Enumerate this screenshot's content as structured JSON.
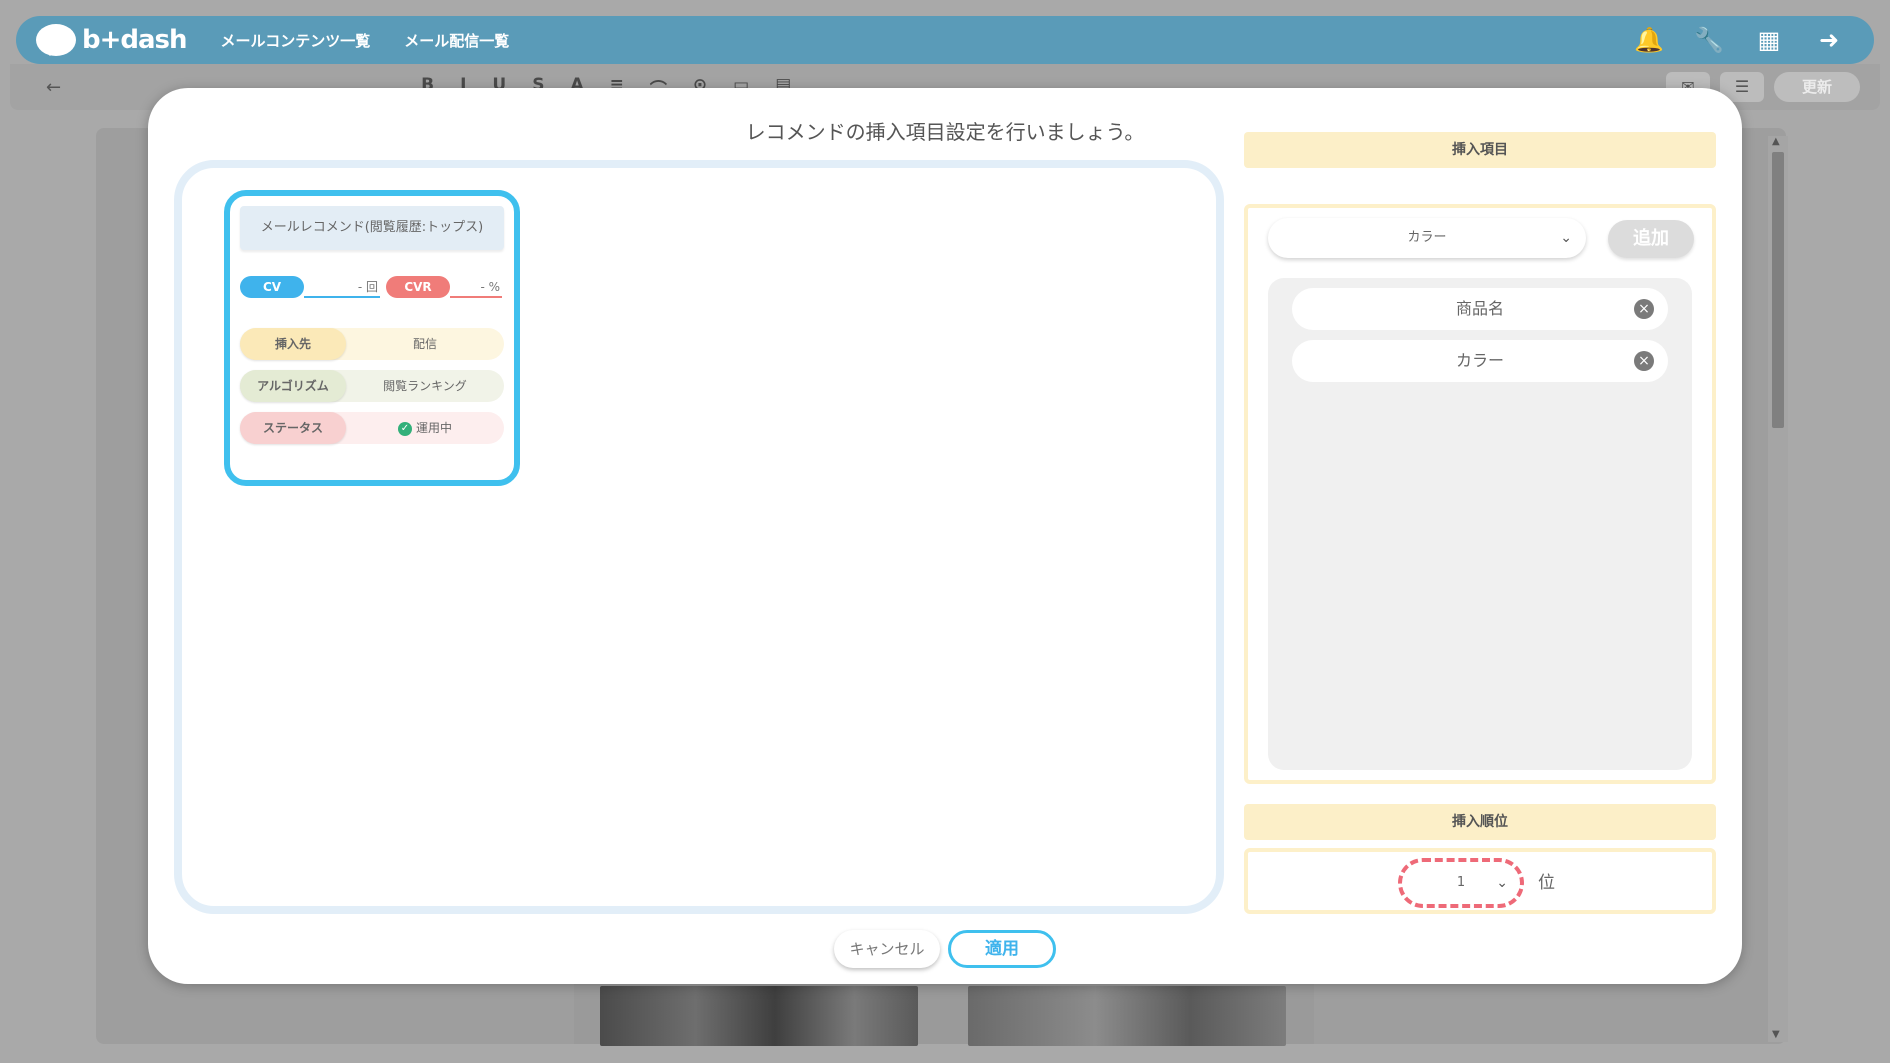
{
  "header": {
    "logo_text": "b+dash",
    "nav": [
      "メールコンテンツ一覧",
      "メール配信一覧"
    ],
    "icons": [
      "bell-icon",
      "wrench-icon",
      "grid-icon",
      "logout-icon"
    ]
  },
  "toolbar": {
    "back_icon": "←",
    "format_icons": [
      "B",
      "I",
      "U",
      "S",
      "A",
      "≡",
      "⌒",
      "⊙",
      "▭",
      "▤"
    ],
    "update_label": "更新"
  },
  "modal": {
    "title": "レコメンドの挿入項目設定を行いましょう。",
    "card": {
      "title": "メールレコメンド(閲覧履歴:トップス)",
      "cv_label": "CV",
      "cv_value": "- 回",
      "cvr_label": "CVR",
      "cvr_value": "- %",
      "rows": [
        {
          "key": "挿入先",
          "value": "配信"
        },
        {
          "key": "アルゴリズム",
          "value": "閲覧ランキング"
        },
        {
          "key": "ステータス",
          "value": "運用中"
        }
      ]
    },
    "items_section": {
      "label": "挿入項目",
      "select_value": "カラー",
      "add_label": "追加",
      "items": [
        "商品名",
        "カラー"
      ]
    },
    "rank_section": {
      "label": "挿入順位",
      "select_value": "1",
      "unit": "位"
    },
    "cancel_label": "キャンセル",
    "apply_label": "適用"
  },
  "colors": {
    "header": "#5a9bb8",
    "accent": "#3fc0ee",
    "cvr": "#f07c79",
    "section": "#fcefc8",
    "highlight": "#ee6a78"
  }
}
